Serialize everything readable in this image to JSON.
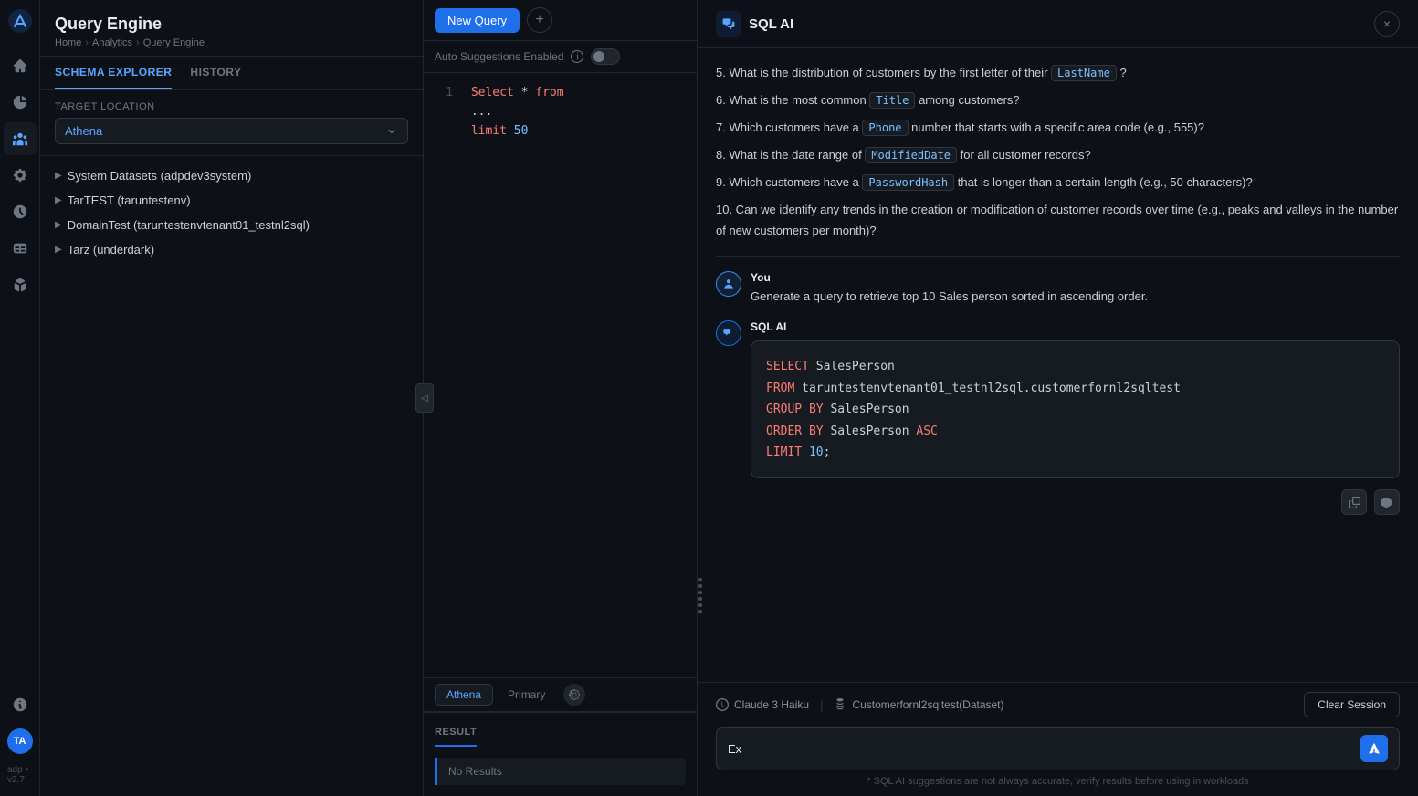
{
  "app": {
    "logo": "adp-logo",
    "version": "adp • v2.7"
  },
  "header": {
    "title": "Query Engine",
    "breadcrumb": [
      "Home",
      "Analytics",
      "Query Engine"
    ]
  },
  "nav": {
    "icons": [
      {
        "name": "home-icon",
        "symbol": "⊞",
        "active": false
      },
      {
        "name": "analytics-icon",
        "symbol": "◈",
        "active": false
      },
      {
        "name": "users-icon",
        "symbol": "◉",
        "active": true
      },
      {
        "name": "settings-icon",
        "symbol": "⚙",
        "active": false
      },
      {
        "name": "activity-icon",
        "symbol": "◎",
        "active": false
      },
      {
        "name": "table-icon",
        "symbol": "⊟",
        "active": false
      },
      {
        "name": "box-icon",
        "symbol": "⊡",
        "active": false
      }
    ],
    "bottom_icons": [
      {
        "name": "info-icon",
        "symbol": "ℹ"
      }
    ],
    "avatar": "TA"
  },
  "schema": {
    "tabs": [
      "SCHEMA EXPLORER",
      "HISTORY"
    ],
    "active_tab": "SCHEMA EXPLORER",
    "target_location_label": "Target Location",
    "target_value": "Athena",
    "items": [
      {
        "label": "System Datasets (adpdev3system)",
        "expanded": false
      },
      {
        "label": "TarTEST (taruntestenv)",
        "expanded": false
      },
      {
        "label": "DomainTest (taruntestenvtenant01_testnl2sql)",
        "expanded": false
      },
      {
        "label": "Tarz (underdark)",
        "expanded": false
      }
    ]
  },
  "query_editor": {
    "tab_label": "New Query",
    "auto_suggestions_label": "Auto Suggestions Enabled",
    "code_lines": [
      {
        "num": 1,
        "code": "Select * from"
      },
      {
        "num": "",
        "code": "..."
      },
      {
        "num": "",
        "code": "limit 50"
      }
    ],
    "engine_tabs": [
      "Athena",
      "Primary"
    ],
    "active_engine": "Athena",
    "result_label": "RESULT",
    "no_results": "No Results"
  },
  "sql_ai": {
    "title": "SQL AI",
    "close_label": "×",
    "questions": [
      {
        "num": "5.",
        "text": "What is the distribution of customers by the first letter of their",
        "code": "LastName",
        "suffix": "?"
      },
      {
        "num": "6.",
        "text": "What is the most common",
        "code": "Title",
        "suffix": "among customers?"
      },
      {
        "num": "7.",
        "text": "Which customers have a",
        "code": "Phone",
        "suffix": "number that starts with a specific area code (e.g., 555)?"
      },
      {
        "num": "8.",
        "text": "What is the date range of",
        "code": "ModifiedDate",
        "suffix": "for all customer records?"
      },
      {
        "num": "9.",
        "text": "Which customers have a",
        "code": "PasswordHash",
        "suffix": "that is longer than a certain length (e.g., 50 characters)?"
      },
      {
        "num": "10.",
        "text": "Can we identify any trends in the creation or modification of customer records over time (e.g., peaks and valleys in the number of new customers per month)?",
        "code": "",
        "suffix": ""
      }
    ],
    "user_message": {
      "sender": "You",
      "text": "Generate a query to retrieve top 10 Sales person sorted in ascending order."
    },
    "ai_response": {
      "sender": "SQL AI",
      "code": [
        "SELECT SalesPerson",
        "FROM taruntestenvtenant01_testnl2sql.customerfornl2sqltest",
        "GROUP BY SalesPerson",
        "ORDER BY SalesPerson ASC",
        "LIMIT 10;"
      ]
    },
    "footer": {
      "model": "Claude 3 Haiku",
      "dataset": "Customerfornl2sqltest(Dataset)",
      "clear_session": "Clear Session"
    },
    "input_placeholder": "Ex",
    "input_value": "Ex",
    "disclaimer": "* SQL AI suggestions are not always accurate, verify results before using in workloads"
  }
}
